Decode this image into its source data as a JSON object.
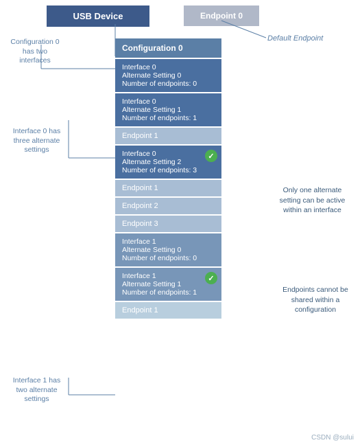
{
  "header": {
    "usb_device_label": "USB Device",
    "endpoint0_label": "Endpoint 0",
    "default_endpoint_label": "Default Endpoint"
  },
  "annotations": {
    "config0_two_interfaces": "Configuration 0\nhas two\ninterfaces",
    "interface0_three_settings": "Interface 0 has\nthree alternate\nsettings",
    "interface0_has": "Interface 0 has",
    "one_alternate_setting": "Only one alternate\nsetting can be active\nwithin an interface",
    "endpoints_cannot_be_shared": "Endpoints cannot be\nshared within a\nconfiguration",
    "interface1_two_settings": "Interface 1 has\ntwo alternate\nsettings"
  },
  "config0": {
    "label": "Configuration 0"
  },
  "interface_blocks": [
    {
      "id": "if0-as0",
      "line1": "Interface 0",
      "line2": "Alternate Setting 0",
      "line3": "Number of endpoints: 0",
      "endpoints": [],
      "active": false
    },
    {
      "id": "if0-as1",
      "line1": "Interface 0",
      "line2": "Alternate Setting 1",
      "line3": "Number of endpoints: 1",
      "endpoints": [
        "Endpoint 1"
      ],
      "active": false
    },
    {
      "id": "if0-as2",
      "line1": "Interface 0",
      "line2": "Alternate Setting 2",
      "line3": "Number of endpoints: 3",
      "endpoints": [
        "Endpoint 1",
        "Endpoint 2",
        "Endpoint 3"
      ],
      "active": true
    },
    {
      "id": "if1-as0",
      "line1": "Interface 1",
      "line2": "Alternate Setting 0",
      "line3": "Number of endpoints: 0",
      "endpoints": [],
      "active": false,
      "variant": "alt"
    },
    {
      "id": "if1-as1",
      "line1": "Interface 1",
      "line2": "Alternate Setting 1",
      "line3": "Number of endpoints: 1",
      "endpoints": [
        "Endpoint 1"
      ],
      "active": true,
      "variant": "alt"
    }
  ],
  "footer": {
    "credit": "CSDN @sului"
  }
}
